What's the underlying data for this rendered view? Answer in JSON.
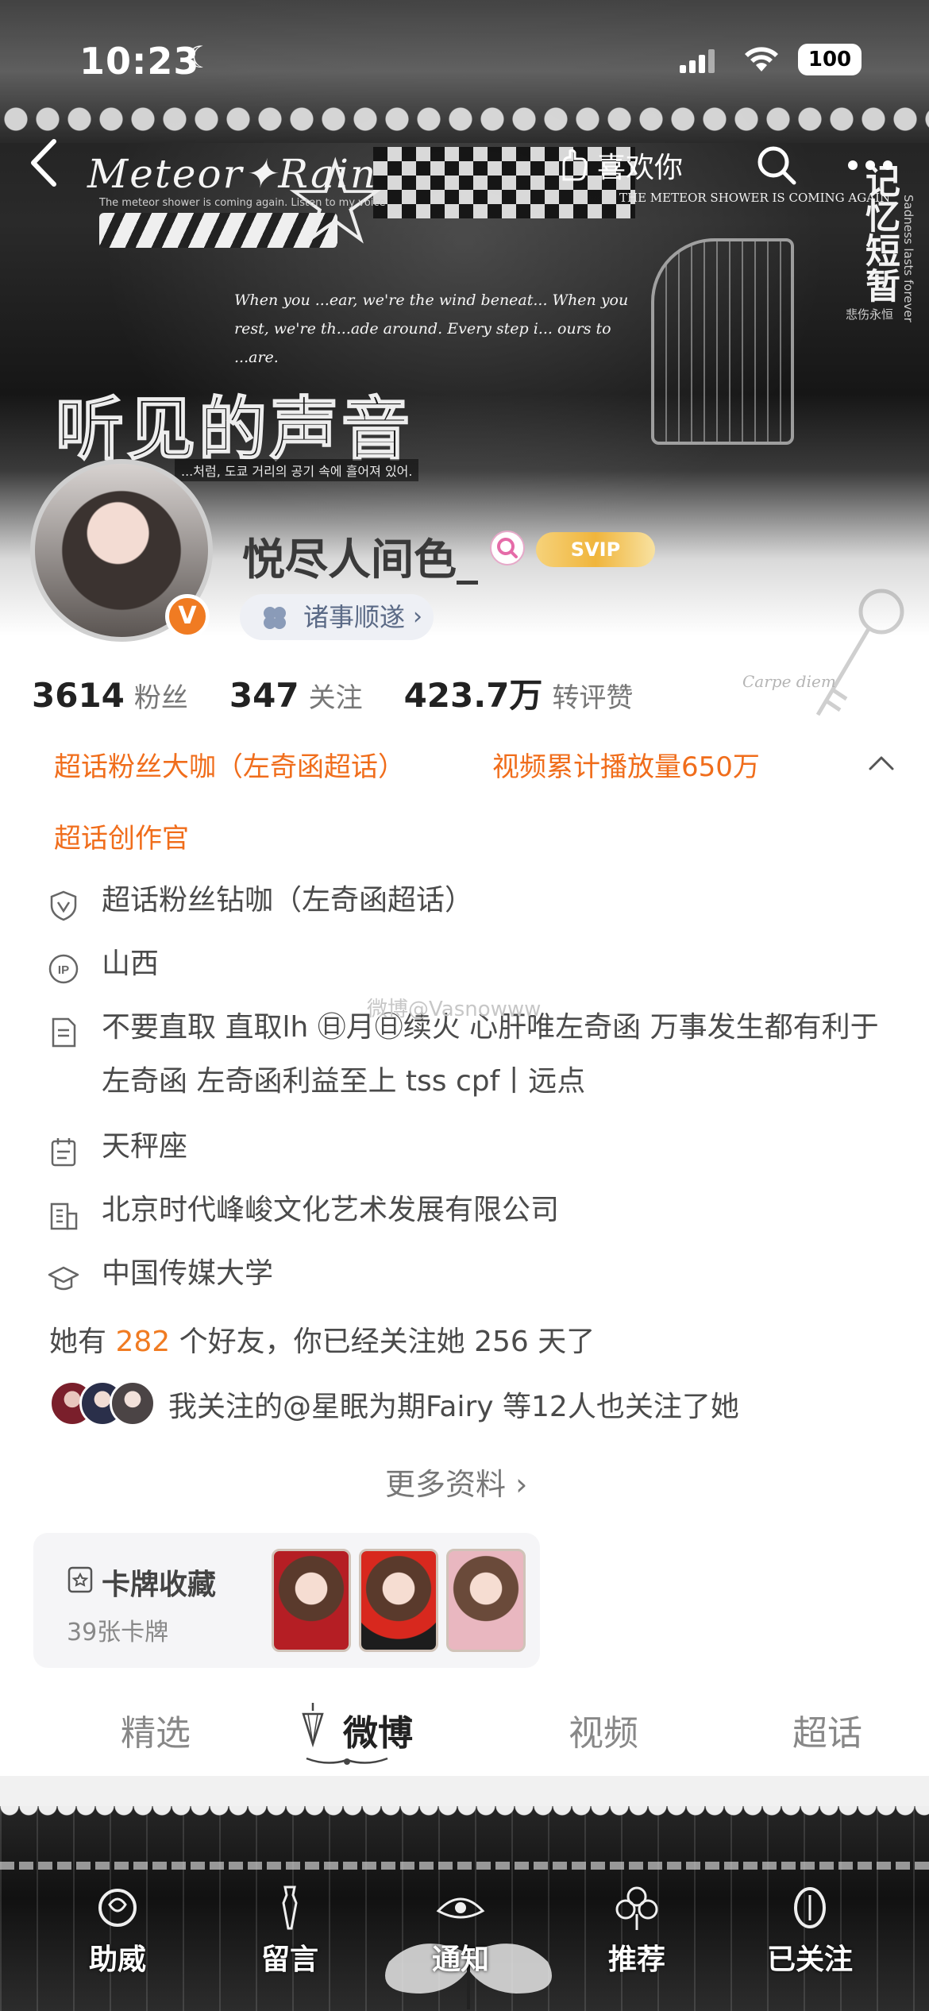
{
  "status_bar": {
    "time": "10:23",
    "battery": "100",
    "icons": [
      "moon-icon",
      "signal-icon",
      "wifi-icon",
      "battery-icon"
    ]
  },
  "banner": {
    "script_title": "Meteor✦Rain",
    "script_sub": "The meteor shower is coming again. Listen to my voice",
    "quote": "When you ...ear, we're the wind beneat... When you rest, we're th...ade around. Every step i... ours to ...are.",
    "big_text": "听见的声音",
    "korean": "...처럼, 도쿄 거리의 공기 속에 흘어져 있어.",
    "right_en": "THE METEOR SHOWER IS COMING AGAIN",
    "right_cn": "记忆短暂",
    "right_cn_small": "悲伤永恒",
    "vertical_en": "Sadness lasts forever",
    "carpe": "Carpe diem"
  },
  "nav": {
    "back_icon": "chevron-left-icon",
    "follow_label": "喜欢你",
    "follow_icon": "hand-heart-icon",
    "search_icon": "search-icon",
    "more_icon": "more-icon"
  },
  "profile": {
    "username": "悦尽人间色_",
    "vip_label": "SVIP",
    "verify_badge": "V",
    "blessing": "诸事顺遂",
    "blessing_arrow": "›",
    "accent_color": "#f07b22"
  },
  "stats": [
    {
      "num": "3614",
      "label": "粉丝"
    },
    {
      "num": "347",
      "label": "关注"
    },
    {
      "num": "423.7万",
      "label": "转评赞"
    }
  ],
  "honors": [
    "超话粉丝大咖（左奇函超话）",
    "视频累计播放量650万",
    "超话创作官"
  ],
  "info": {
    "super_topic": "超话粉丝钻咖（左奇函超话）",
    "ip": "山西",
    "bio": "不要直取 直取lh ㊐月㊐续火 心肝唯左奇函 万事发生都有利于左奇函 左奇函利益至上 tss cpf丨远点",
    "zodiac": "天秤座",
    "company": "北京时代峰峻文化艺术发展有限公司",
    "school": "中国传媒大学"
  },
  "watermark": "微博@Vasnowww",
  "friends": {
    "prefix": "她有",
    "count": "282",
    "suffix": "个好友，你已经关注她 256 天了"
  },
  "mutual": {
    "text": "我关注的@星眠为期Fairy 等12人也关注了她"
  },
  "more_info": "更多资料 ›",
  "card_collection": {
    "title": "卡牌收藏",
    "count": "39张卡牌"
  },
  "tabs": [
    {
      "label": "精选",
      "active": false
    },
    {
      "label": "微博",
      "active": true
    },
    {
      "label": "视频",
      "active": false
    },
    {
      "label": "超话",
      "active": false
    }
  ],
  "bottom_bar": [
    {
      "label": "助威",
      "icon": "cheer-icon"
    },
    {
      "label": "留言",
      "icon": "message-icon"
    },
    {
      "label": "通知",
      "icon": "bell-icon"
    },
    {
      "label": "推荐",
      "icon": "recommend-icon"
    },
    {
      "label": "已关注",
      "icon": "followed-icon"
    }
  ]
}
